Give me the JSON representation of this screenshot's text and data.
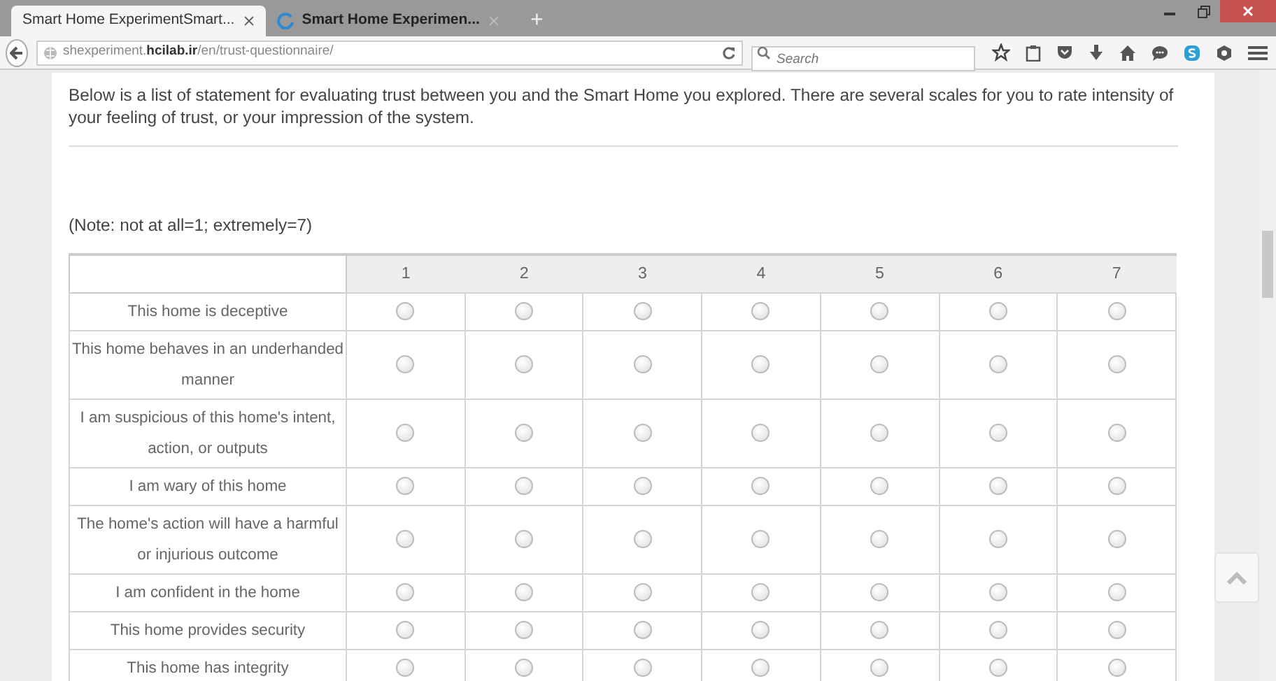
{
  "browser": {
    "tabs": [
      {
        "title": "Smart Home ExperimentSmart...",
        "selected": true,
        "loading": false
      },
      {
        "title": "Smart Home Experimen...",
        "selected": false,
        "loading": true
      }
    ],
    "new_tab": "+",
    "address": "shexperiment.**hcilab.ir**/en/trust-questionnaire/",
    "search": {
      "placeholder": "Search"
    }
  },
  "page": {
    "intro": "Below is a list of statement for evaluating trust between you and the Smart Home you explored. There are several scales for you to rate intensity of your feeling of trust, or your impression of the system.",
    "note": "(Note: not at all=1; extremely=7)",
    "table": {
      "columns": [
        "1",
        "2",
        "3",
        "4",
        "5",
        "6",
        "7"
      ],
      "rows": [
        {
          "statement": "This home is deceptive",
          "choices": [
            false,
            false,
            false,
            false,
            false,
            false,
            false
          ]
        },
        {
          "statement": "This home behaves in an underhanded manner",
          "choices": [
            false,
            false,
            false,
            false,
            false,
            false,
            false
          ]
        },
        {
          "statement": "I am suspicious of this home's intent, action, or outputs",
          "choices": [
            false,
            false,
            false,
            false,
            false,
            false,
            false
          ]
        },
        {
          "statement": "I am wary of this home",
          "choices": [
            false,
            false,
            false,
            false,
            false,
            false,
            false
          ]
        },
        {
          "statement": "The home's action will have a harmful or injurious outcome",
          "choices": [
            false,
            false,
            false,
            false,
            false,
            false,
            false
          ]
        },
        {
          "statement": "I am confident in the home",
          "choices": [
            false,
            false,
            false,
            false,
            false,
            false,
            false
          ]
        },
        {
          "statement": "This home provides security",
          "choices": [
            false,
            false,
            false,
            false,
            false,
            false,
            false
          ]
        },
        {
          "statement": "This home has integrity",
          "choices": [
            false,
            false,
            false,
            false,
            false,
            false,
            false
          ]
        }
      ]
    }
  }
}
